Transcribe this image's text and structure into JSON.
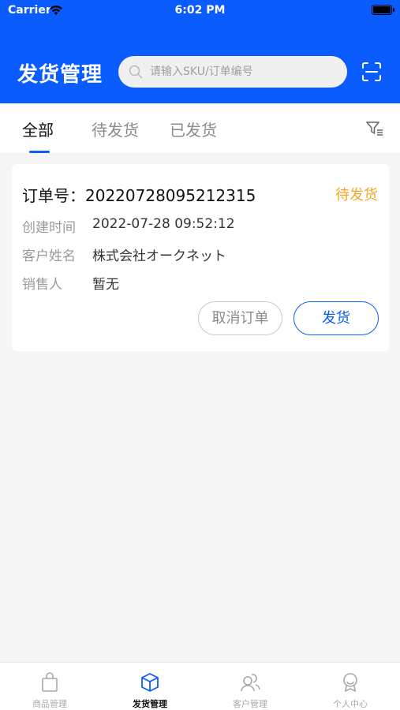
{
  "status_bar": {
    "carrier": "Carrier",
    "time": "6:02 PM"
  },
  "header": {
    "title": "发货管理",
    "search_placeholder": "请输入SKU/订单编号",
    "bg_color": "#0b5cff"
  },
  "tabs": [
    {
      "label": "全部",
      "active": true
    },
    {
      "label": "待发货",
      "active": false
    },
    {
      "label": "已发货",
      "active": false
    }
  ],
  "order": {
    "order_no_label": "订单号：",
    "order_no": "20220728095212315",
    "status": "待发货",
    "fields": [
      {
        "label": "创建时间",
        "value": "2022-07-28 09:52:12"
      },
      {
        "label": "客户姓名",
        "value": "株式会社オークネット"
      },
      {
        "label": "销售人",
        "value": "暂无"
      }
    ],
    "cancel_label": "取消订单",
    "ship_label": "发货"
  },
  "bottom_nav": [
    {
      "label": "商品管理",
      "icon": "bag-icon",
      "active": false
    },
    {
      "label": "发货管理",
      "icon": "box-icon",
      "active": true
    },
    {
      "label": "客户管理",
      "icon": "users-icon",
      "active": false
    },
    {
      "label": "个人中心",
      "icon": "user-badge-icon",
      "active": false
    }
  ],
  "colors": {
    "accent": "#0b5cff",
    "pending": "#f5a623"
  }
}
